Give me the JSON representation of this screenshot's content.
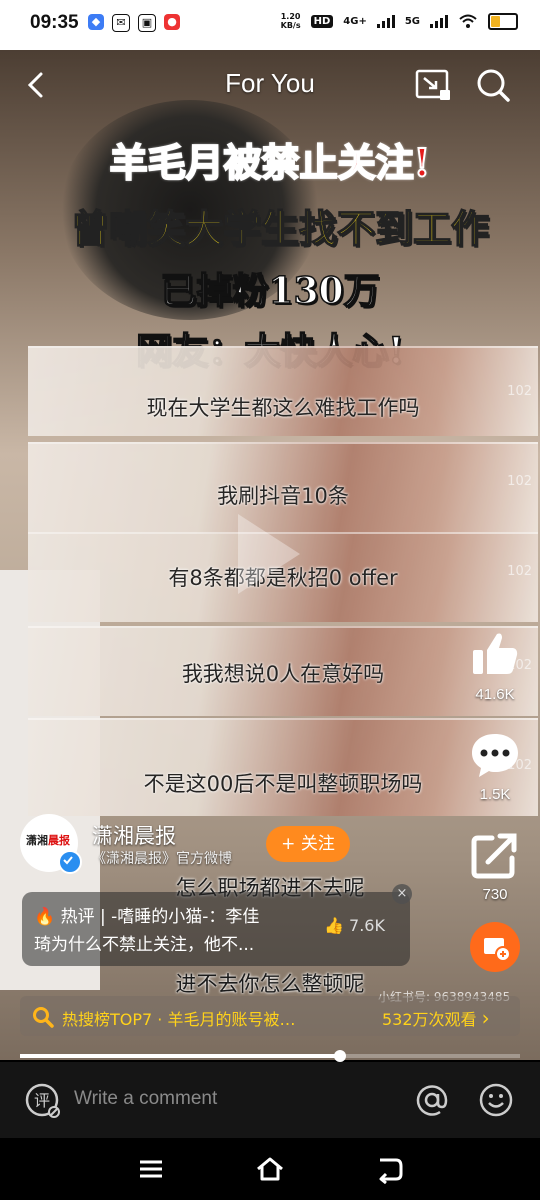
{
  "status_bar": {
    "time": "09:35",
    "net_speed_value": "1.20",
    "net_speed_unit": "KB/s",
    "hd_label": "HD",
    "net_4g": "4G+",
    "net_5g": "5G",
    "battery_color": "#f2b321"
  },
  "nav": {
    "title": "For You"
  },
  "video": {
    "headline_1": "羊毛月被禁止关注!",
    "headline_2": "曾嘲笑大学生找不到工作",
    "headline_3": "已掉粉130万",
    "headline_4": "网友：大快人心!",
    "strip_captions": [
      "现在大学生都这么难找工作吗",
      "我刷抖音10条",
      "有8条都都是秋招0 offer",
      "我我想说0人在意好吗",
      "不是这00后不是叫整顿职场吗"
    ],
    "caption_6": "怎么职场都进不去呢",
    "caption_7": "进不去你怎么整顿呢",
    "strip_num": "102",
    "watermark": "小红书号: 9638943485"
  },
  "actions": {
    "likes": "41.6K",
    "comments": "1.5K",
    "shares": "730"
  },
  "account": {
    "logo_text_black": "潇湘",
    "logo_text_red": "晨报",
    "name": "潇湘晨报",
    "subtitle": "《潇湘晨报》官方微博",
    "follow_label": "+ 关注"
  },
  "hot_comment": {
    "line1": "🔥 热评 | -嗜睡的小猫-：李佳",
    "line2": "琦为什么不禁止关注，他不...",
    "likes": "7.6K",
    "close": "×"
  },
  "trending": {
    "text": "热搜榜TOP7 · 羊毛月的账号被…",
    "views": "532万次观看",
    "arrow": "›"
  },
  "progress": {
    "fraction": 0.64
  },
  "comment_bar": {
    "placeholder": "Write a comment",
    "comment_glyph": "评"
  },
  "colors": {
    "accent_orange": "#ff8a1e",
    "trend_yellow": "#ffd21a",
    "headline_red": "#e51c1c",
    "headline_yellow": "#ffe21a"
  }
}
